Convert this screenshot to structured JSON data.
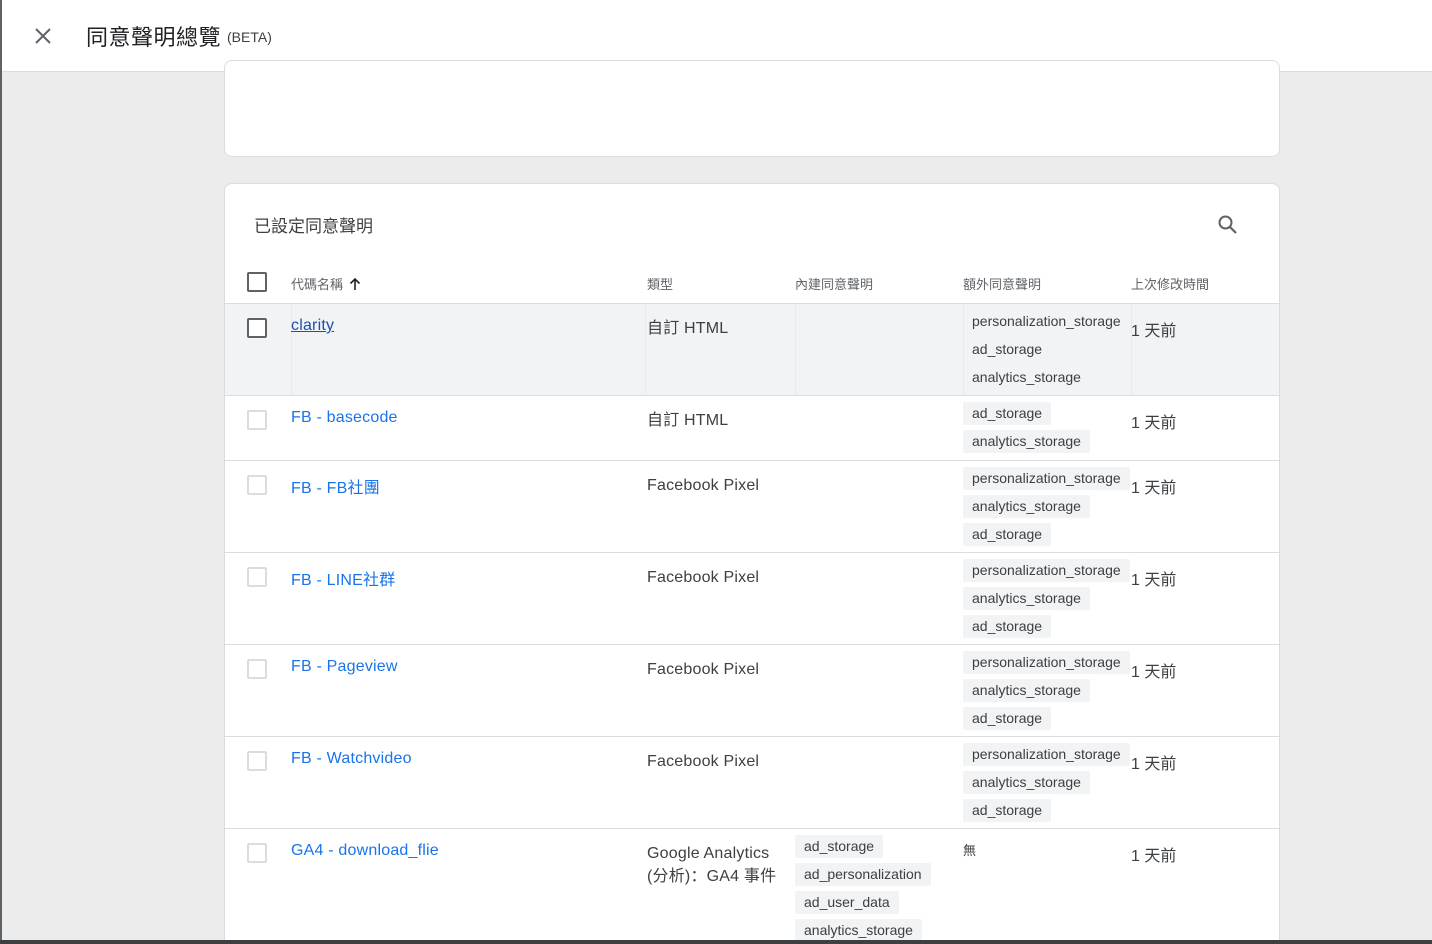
{
  "header": {
    "title": "同意聲明總覽",
    "beta": "(BETA)"
  },
  "card": {
    "title": "已設定同意聲明"
  },
  "table": {
    "columns": {
      "name": "代碼名稱",
      "type": "類型",
      "builtin": "內建同意聲明",
      "additional": "額外同意聲明",
      "modified": "上次修改時間"
    },
    "rows": [
      {
        "name": "clarity",
        "type": "自訂 HTML",
        "builtin": [],
        "additional": [
          "personalization_storage",
          "ad_storage",
          "analytics_storage"
        ],
        "modified": "1 天前"
      },
      {
        "name": "FB - basecode",
        "type": "自訂 HTML",
        "builtin": [],
        "additional": [
          "ad_storage",
          "analytics_storage"
        ],
        "modified": "1 天前"
      },
      {
        "name": "FB - FB社團",
        "type": "Facebook Pixel",
        "builtin": [],
        "additional": [
          "personalization_storage",
          "analytics_storage",
          "ad_storage"
        ],
        "modified": "1 天前"
      },
      {
        "name": "FB - LINE社群",
        "type": "Facebook Pixel",
        "builtin": [],
        "additional": [
          "personalization_storage",
          "analytics_storage",
          "ad_storage"
        ],
        "modified": "1 天前"
      },
      {
        "name": "FB - Pageview",
        "type": "Facebook Pixel",
        "builtin": [],
        "additional": [
          "personalization_storage",
          "analytics_storage",
          "ad_storage"
        ],
        "modified": "1 天前"
      },
      {
        "name": "FB - Watchvideo",
        "type": "Facebook Pixel",
        "builtin": [],
        "additional": [
          "personalization_storage",
          "analytics_storage",
          "ad_storage"
        ],
        "modified": "1 天前"
      },
      {
        "name": "GA4 - download_flie",
        "type_line1": "Google Analytics",
        "type_line2": "(分析)：GA4 事件",
        "builtin": [
          "ad_storage",
          "ad_personalization",
          "ad_user_data",
          "analytics_storage"
        ],
        "additional_none": "無",
        "modified": "1 天前"
      }
    ]
  }
}
